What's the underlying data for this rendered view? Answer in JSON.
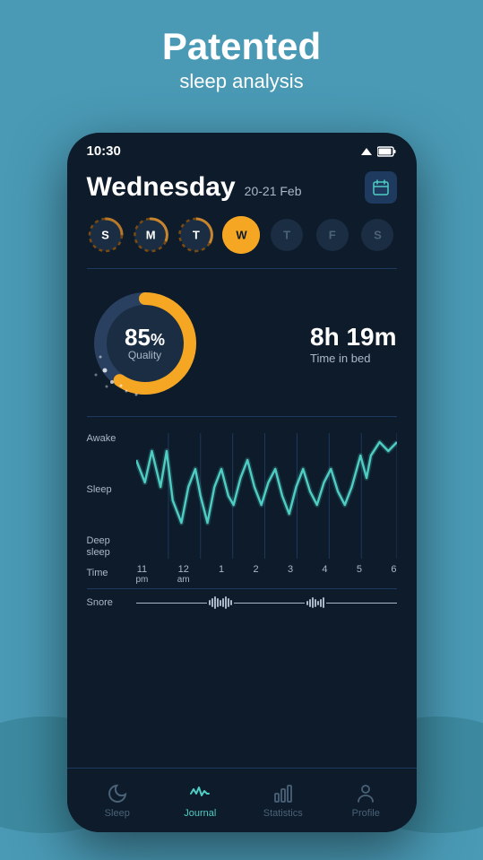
{
  "header": {
    "title": "Patented",
    "subtitle": "sleep analysis"
  },
  "statusBar": {
    "time": "10:30"
  },
  "dateHeader": {
    "dayName": "Wednesday",
    "dateRange": "20-21 Feb"
  },
  "daySelector": {
    "days": [
      {
        "label": "S",
        "state": "ring",
        "ringColor": "#b8782a"
      },
      {
        "label": "M",
        "state": "ring",
        "ringColor": "#c8852e"
      },
      {
        "label": "T",
        "state": "ring",
        "ringColor": "#c8852e"
      },
      {
        "label": "W",
        "state": "active"
      },
      {
        "label": "T",
        "state": "inactive"
      },
      {
        "label": "F",
        "state": "inactive"
      },
      {
        "label": "S",
        "state": "inactive"
      }
    ]
  },
  "sleepQuality": {
    "percent": "85",
    "percentSymbol": "%",
    "qualityLabel": "Quality",
    "timeValue": "8h 19m",
    "timeLabel": "Time in bed"
  },
  "chart": {
    "yLabels": [
      "Awake",
      "Sleep",
      "Deep\nsleep"
    ],
    "xLabels": [
      {
        "main": "11",
        "sub": "pm"
      },
      {
        "main": "12",
        "sub": "am"
      },
      {
        "main": "1",
        "sub": ""
      },
      {
        "main": "2",
        "sub": ""
      },
      {
        "main": "3",
        "sub": ""
      },
      {
        "main": "4",
        "sub": ""
      },
      {
        "main": "5",
        "sub": ""
      },
      {
        "main": "6",
        "sub": ""
      }
    ],
    "timeLabel": "Time"
  },
  "snore": {
    "label": "Snore"
  },
  "bottomNav": {
    "items": [
      {
        "label": "Sleep",
        "state": "inactive",
        "icon": "moon"
      },
      {
        "label": "Journal",
        "state": "active",
        "icon": "wave"
      },
      {
        "label": "Statistics",
        "state": "inactive",
        "icon": "bar-chart"
      },
      {
        "label": "Profile",
        "state": "inactive",
        "icon": "person"
      }
    ]
  },
  "colors": {
    "accent": "#f5a623",
    "teal": "#4ecdc4",
    "dark": "#0d1b2a",
    "dimText": "#aab8c8"
  }
}
